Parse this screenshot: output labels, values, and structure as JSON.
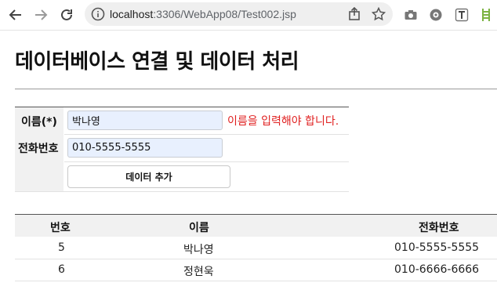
{
  "browser": {
    "url_host": "localhost",
    "url_rest": ":3306/WebApp08/Test002.jsp"
  },
  "page": {
    "title": "데이터베이스 연결 및 데이터 처리"
  },
  "form": {
    "name_label": "이름(*)",
    "name_value": "박나영",
    "name_error": "이름을 입력해야 합니다.",
    "phone_label": "전화번호",
    "phone_value": "010-5555-5555",
    "submit_label": "데이터 추가"
  },
  "table": {
    "headers": [
      "번호",
      "이름",
      "전화번호"
    ],
    "rows": [
      [
        "5",
        "박나영",
        "010-5555-5555"
      ],
      [
        "6",
        "정현욱",
        "010-6666-6666"
      ]
    ]
  },
  "colors": {
    "error": "#e02020",
    "input_autofill": "#e8f0fe"
  }
}
